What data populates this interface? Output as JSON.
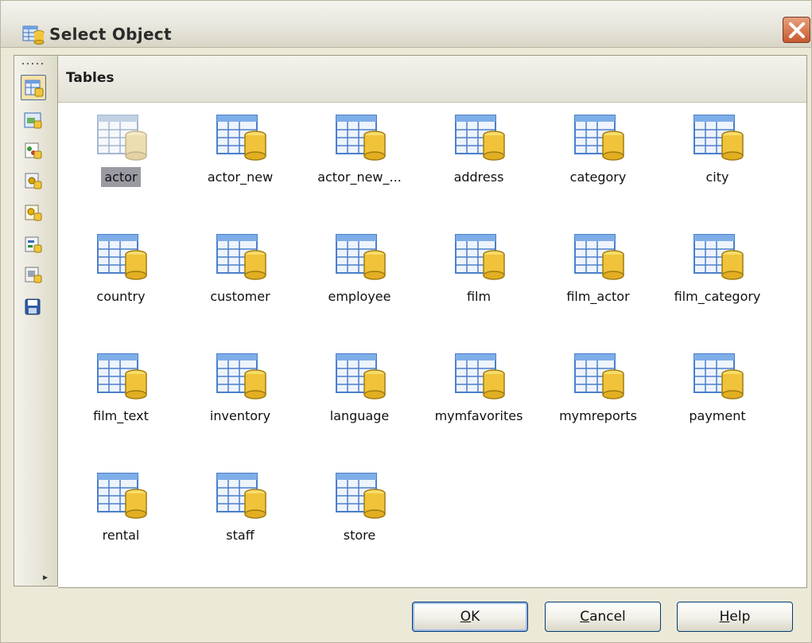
{
  "window": {
    "title": "Select Object",
    "close_icon": "close-icon"
  },
  "toolbar": {
    "buttons": [
      {
        "name": "tables",
        "icon": "table-icon"
      },
      {
        "name": "views",
        "icon": "view-icon"
      },
      {
        "name": "procedures",
        "icon": "procedure-icon"
      },
      {
        "name": "functions",
        "icon": "function-icon"
      },
      {
        "name": "triggers",
        "icon": "trigger-icon"
      },
      {
        "name": "events",
        "icon": "event-icon"
      },
      {
        "name": "udfs",
        "icon": "udf-icon"
      },
      {
        "name": "save",
        "icon": "floppy-icon"
      }
    ],
    "more_icon": "chevron-right-icon"
  },
  "panel": {
    "title": "Tables",
    "items": [
      {
        "label": "actor",
        "selected": true
      },
      {
        "label": "actor_new"
      },
      {
        "label": "actor_new_..."
      },
      {
        "label": "address"
      },
      {
        "label": "category"
      },
      {
        "label": "city"
      },
      {
        "label": "country"
      },
      {
        "label": "customer"
      },
      {
        "label": "employee"
      },
      {
        "label": "film"
      },
      {
        "label": "film_actor"
      },
      {
        "label": "film_category"
      },
      {
        "label": "film_text"
      },
      {
        "label": "inventory"
      },
      {
        "label": "language"
      },
      {
        "label": "mymfavorites"
      },
      {
        "label": "mymreports"
      },
      {
        "label": "payment"
      },
      {
        "label": "rental"
      },
      {
        "label": "staff"
      },
      {
        "label": "store"
      }
    ]
  },
  "buttons": {
    "ok": {
      "accel": "O",
      "rest": "K"
    },
    "cancel": {
      "accel": "C",
      "rest": "ancel"
    },
    "help": {
      "accel": "H",
      "rest": "elp"
    }
  },
  "colors": {
    "selection": "#9a9aa3",
    "titlebar": "#e8e6dc",
    "close": "#c8582f"
  }
}
